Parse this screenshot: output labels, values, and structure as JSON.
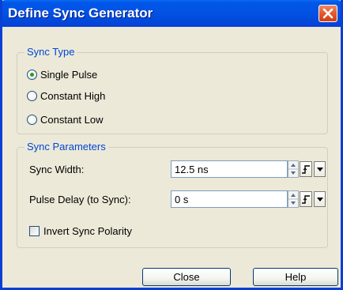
{
  "window": {
    "title": "Define Sync Generator"
  },
  "sync_type": {
    "legend": "Sync Type",
    "options": [
      {
        "label": "Single Pulse",
        "selected": true
      },
      {
        "label": "Constant High",
        "selected": false
      },
      {
        "label": "Constant Low",
        "selected": false
      }
    ]
  },
  "sync_parameters": {
    "legend": "Sync Parameters",
    "sync_width": {
      "label": "Sync Width:",
      "value": "12.5 ns"
    },
    "pulse_delay": {
      "label": "Pulse Delay (to Sync):",
      "value": "0 s"
    },
    "invert": {
      "label": "Invert Sync Polarity",
      "checked": false
    }
  },
  "buttons": {
    "close": "Close",
    "help": "Help"
  },
  "colors": {
    "titlebar": "#0253e4",
    "legend_text": "#0046d5",
    "radio_selected": "#21a121",
    "dialog_bg": "#ece9d8"
  },
  "icons": {
    "title_close": "close-x-icon",
    "spinner": "spinner-up-down-icon",
    "edge": "rising-edge-icon",
    "dropdown": "chevron-down-icon"
  }
}
